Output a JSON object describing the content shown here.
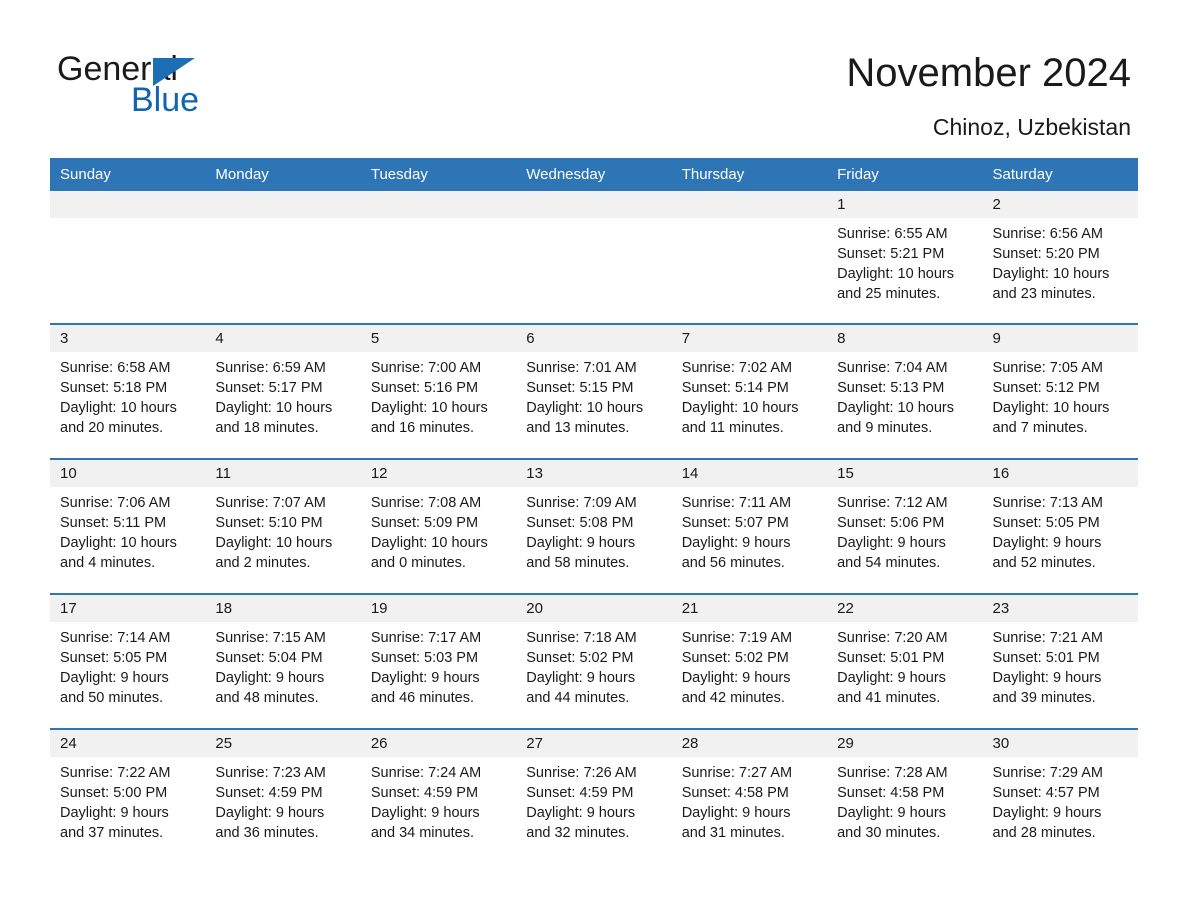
{
  "brand": {
    "name_part1": "General",
    "name_part2": "Blue",
    "triangle_color": "#1c6fb5",
    "blue_text_color": "#1064b0"
  },
  "header": {
    "month_year": "November 2024",
    "location": "Chinoz, Uzbekistan",
    "accent_color": "#2e75b6",
    "band_color": "#f1f1f1"
  },
  "weekday_headers": [
    "Sunday",
    "Monday",
    "Tuesday",
    "Wednesday",
    "Thursday",
    "Friday",
    "Saturday"
  ],
  "labels": {
    "sunrise_prefix": "Sunrise:",
    "sunset_prefix": "Sunset:",
    "daylight_prefix": "Daylight:"
  },
  "weeks": [
    [
      {
        "day": "",
        "sunrise": "",
        "sunset": "",
        "daylight_line1": "",
        "daylight_line2": ""
      },
      {
        "day": "",
        "sunrise": "",
        "sunset": "",
        "daylight_line1": "",
        "daylight_line2": ""
      },
      {
        "day": "",
        "sunrise": "",
        "sunset": "",
        "daylight_line1": "",
        "daylight_line2": ""
      },
      {
        "day": "",
        "sunrise": "",
        "sunset": "",
        "daylight_line1": "",
        "daylight_line2": ""
      },
      {
        "day": "",
        "sunrise": "",
        "sunset": "",
        "daylight_line1": "",
        "daylight_line2": ""
      },
      {
        "day": "1",
        "sunrise": "Sunrise: 6:55 AM",
        "sunset": "Sunset: 5:21 PM",
        "daylight_line1": "Daylight: 10 hours",
        "daylight_line2": "and 25 minutes."
      },
      {
        "day": "2",
        "sunrise": "Sunrise: 6:56 AM",
        "sunset": "Sunset: 5:20 PM",
        "daylight_line1": "Daylight: 10 hours",
        "daylight_line2": "and 23 minutes."
      }
    ],
    [
      {
        "day": "3",
        "sunrise": "Sunrise: 6:58 AM",
        "sunset": "Sunset: 5:18 PM",
        "daylight_line1": "Daylight: 10 hours",
        "daylight_line2": "and 20 minutes."
      },
      {
        "day": "4",
        "sunrise": "Sunrise: 6:59 AM",
        "sunset": "Sunset: 5:17 PM",
        "daylight_line1": "Daylight: 10 hours",
        "daylight_line2": "and 18 minutes."
      },
      {
        "day": "5",
        "sunrise": "Sunrise: 7:00 AM",
        "sunset": "Sunset: 5:16 PM",
        "daylight_line1": "Daylight: 10 hours",
        "daylight_line2": "and 16 minutes."
      },
      {
        "day": "6",
        "sunrise": "Sunrise: 7:01 AM",
        "sunset": "Sunset: 5:15 PM",
        "daylight_line1": "Daylight: 10 hours",
        "daylight_line2": "and 13 minutes."
      },
      {
        "day": "7",
        "sunrise": "Sunrise: 7:02 AM",
        "sunset": "Sunset: 5:14 PM",
        "daylight_line1": "Daylight: 10 hours",
        "daylight_line2": "and 11 minutes."
      },
      {
        "day": "8",
        "sunrise": "Sunrise: 7:04 AM",
        "sunset": "Sunset: 5:13 PM",
        "daylight_line1": "Daylight: 10 hours",
        "daylight_line2": "and 9 minutes."
      },
      {
        "day": "9",
        "sunrise": "Sunrise: 7:05 AM",
        "sunset": "Sunset: 5:12 PM",
        "daylight_line1": "Daylight: 10 hours",
        "daylight_line2": "and 7 minutes."
      }
    ],
    [
      {
        "day": "10",
        "sunrise": "Sunrise: 7:06 AM",
        "sunset": "Sunset: 5:11 PM",
        "daylight_line1": "Daylight: 10 hours",
        "daylight_line2": "and 4 minutes."
      },
      {
        "day": "11",
        "sunrise": "Sunrise: 7:07 AM",
        "sunset": "Sunset: 5:10 PM",
        "daylight_line1": "Daylight: 10 hours",
        "daylight_line2": "and 2 minutes."
      },
      {
        "day": "12",
        "sunrise": "Sunrise: 7:08 AM",
        "sunset": "Sunset: 5:09 PM",
        "daylight_line1": "Daylight: 10 hours",
        "daylight_line2": "and 0 minutes."
      },
      {
        "day": "13",
        "sunrise": "Sunrise: 7:09 AM",
        "sunset": "Sunset: 5:08 PM",
        "daylight_line1": "Daylight: 9 hours",
        "daylight_line2": "and 58 minutes."
      },
      {
        "day": "14",
        "sunrise": "Sunrise: 7:11 AM",
        "sunset": "Sunset: 5:07 PM",
        "daylight_line1": "Daylight: 9 hours",
        "daylight_line2": "and 56 minutes."
      },
      {
        "day": "15",
        "sunrise": "Sunrise: 7:12 AM",
        "sunset": "Sunset: 5:06 PM",
        "daylight_line1": "Daylight: 9 hours",
        "daylight_line2": "and 54 minutes."
      },
      {
        "day": "16",
        "sunrise": "Sunrise: 7:13 AM",
        "sunset": "Sunset: 5:05 PM",
        "daylight_line1": "Daylight: 9 hours",
        "daylight_line2": "and 52 minutes."
      }
    ],
    [
      {
        "day": "17",
        "sunrise": "Sunrise: 7:14 AM",
        "sunset": "Sunset: 5:05 PM",
        "daylight_line1": "Daylight: 9 hours",
        "daylight_line2": "and 50 minutes."
      },
      {
        "day": "18",
        "sunrise": "Sunrise: 7:15 AM",
        "sunset": "Sunset: 5:04 PM",
        "daylight_line1": "Daylight: 9 hours",
        "daylight_line2": "and 48 minutes."
      },
      {
        "day": "19",
        "sunrise": "Sunrise: 7:17 AM",
        "sunset": "Sunset: 5:03 PM",
        "daylight_line1": "Daylight: 9 hours",
        "daylight_line2": "and 46 minutes."
      },
      {
        "day": "20",
        "sunrise": "Sunrise: 7:18 AM",
        "sunset": "Sunset: 5:02 PM",
        "daylight_line1": "Daylight: 9 hours",
        "daylight_line2": "and 44 minutes."
      },
      {
        "day": "21",
        "sunrise": "Sunrise: 7:19 AM",
        "sunset": "Sunset: 5:02 PM",
        "daylight_line1": "Daylight: 9 hours",
        "daylight_line2": "and 42 minutes."
      },
      {
        "day": "22",
        "sunrise": "Sunrise: 7:20 AM",
        "sunset": "Sunset: 5:01 PM",
        "daylight_line1": "Daylight: 9 hours",
        "daylight_line2": "and 41 minutes."
      },
      {
        "day": "23",
        "sunrise": "Sunrise: 7:21 AM",
        "sunset": "Sunset: 5:01 PM",
        "daylight_line1": "Daylight: 9 hours",
        "daylight_line2": "and 39 minutes."
      }
    ],
    [
      {
        "day": "24",
        "sunrise": "Sunrise: 7:22 AM",
        "sunset": "Sunset: 5:00 PM",
        "daylight_line1": "Daylight: 9 hours",
        "daylight_line2": "and 37 minutes."
      },
      {
        "day": "25",
        "sunrise": "Sunrise: 7:23 AM",
        "sunset": "Sunset: 4:59 PM",
        "daylight_line1": "Daylight: 9 hours",
        "daylight_line2": "and 36 minutes."
      },
      {
        "day": "26",
        "sunrise": "Sunrise: 7:24 AM",
        "sunset": "Sunset: 4:59 PM",
        "daylight_line1": "Daylight: 9 hours",
        "daylight_line2": "and 34 minutes."
      },
      {
        "day": "27",
        "sunrise": "Sunrise: 7:26 AM",
        "sunset": "Sunset: 4:59 PM",
        "daylight_line1": "Daylight: 9 hours",
        "daylight_line2": "and 32 minutes."
      },
      {
        "day": "28",
        "sunrise": "Sunrise: 7:27 AM",
        "sunset": "Sunset: 4:58 PM",
        "daylight_line1": "Daylight: 9 hours",
        "daylight_line2": "and 31 minutes."
      },
      {
        "day": "29",
        "sunrise": "Sunrise: 7:28 AM",
        "sunset": "Sunset: 4:58 PM",
        "daylight_line1": "Daylight: 9 hours",
        "daylight_line2": "and 30 minutes."
      },
      {
        "day": "30",
        "sunrise": "Sunrise: 7:29 AM",
        "sunset": "Sunset: 4:57 PM",
        "daylight_line1": "Daylight: 9 hours",
        "daylight_line2": "and 28 minutes."
      }
    ]
  ]
}
